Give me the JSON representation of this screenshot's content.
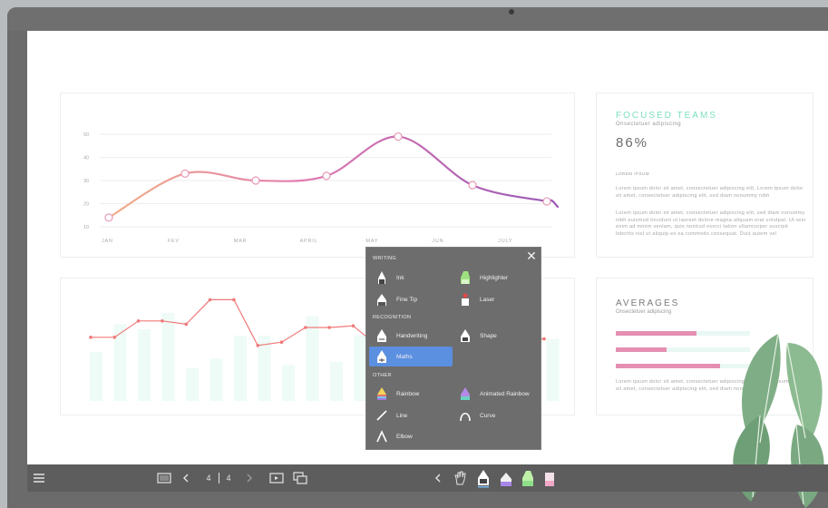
{
  "line_chart": {
    "y_ticks": [
      "50",
      "40",
      "30",
      "20",
      "10"
    ],
    "x_labels": [
      "JAN",
      "FEV",
      "MAR",
      "APRIL",
      "MAY",
      "JUN",
      "JULY"
    ],
    "chart_data": {
      "type": "line",
      "x": [
        1,
        2,
        3,
        4,
        5,
        6,
        7,
        8
      ],
      "values": [
        14,
        33,
        30,
        32,
        49,
        28,
        21
      ],
      "ylim": [
        10,
        50
      ],
      "grid": true,
      "line_colors": [
        "#f2b089",
        "#e07bb0",
        "#9b59b6"
      ]
    }
  },
  "bar_chart": {
    "chart_data": {
      "type": "bar",
      "bar_values": [
        30,
        47,
        44,
        54,
        20,
        26,
        40,
        40,
        22,
        52,
        24,
        40,
        40,
        38,
        38,
        38,
        38,
        40,
        38,
        38
      ],
      "line_values": [
        39,
        39,
        49,
        49,
        47,
        62,
        62,
        34,
        36,
        45,
        45,
        46,
        34,
        42,
        57,
        57,
        36,
        36,
        38,
        38
      ],
      "bar_color": "#eefbf6",
      "line_color": "#f07a7a"
    }
  },
  "focused_teams": {
    "title": "FOCUSED TEAMS",
    "subtitle": "Onsectetuer adipiscing",
    "value": "86%",
    "lorem_heading": "LOREM IPSUM",
    "para1": "Lorem ipsum dolor sit amet, consectetuer adipiscing elit, Lorem ipsum dolor sit amet, consectetuer adipiscing elit, sed diam nonummy nibh",
    "para2": "Lorem ipsum dolor sit amet, consectetuer adipiscing elit, sed diam nonummy nibh euismod tincidunt ut laoreet dolore magna aliquam erat volutpat. Ut wisi enim ad minim veniam, quis nostrud exerci tation ullamcorper suscipit lobortis nisl ut aliquip ex ea commodo consequat. Duis autem vel"
  },
  "averages": {
    "title": "AVERAGES",
    "subtitle": "Onsectetuer adipiscing",
    "bars": [
      0.6,
      0.38,
      0.78
    ],
    "para": "Lorem ipsum dolor sit amet, consectetuer adipiscing elit, Lorem ipsum dolor sit amet, consectetuer adipiscing elit, sed diam nonummy nibh"
  },
  "popup": {
    "sections": {
      "writing": "WRITING",
      "recognition": "RECOGNITION",
      "other": "OTHER"
    },
    "items": {
      "ink": "Ink",
      "highlighter": "Highlighter",
      "fine_tip": "Fine Tip",
      "laser": "Laser",
      "handwriting": "Handwriting",
      "shape": "Shape",
      "maths": "Maths",
      "rainbow": "Rainbow",
      "animated_rainbow": "Animated Rainbow",
      "line": "Line",
      "curve": "Curve",
      "elbow": "Elbow"
    },
    "selected": "maths",
    "close_icon": "close-icon"
  },
  "taskbar": {
    "page_current": "4",
    "page_total": "4",
    "icons": [
      "menu-icon",
      "whiteboard-icon",
      "prev-page-icon",
      "next-page-icon",
      "present-icon",
      "windows-icon",
      "collapse-icon",
      "hand-icon",
      "pen-icon",
      "fine-pen-icon",
      "highlighter-icon",
      "eraser-icon"
    ]
  },
  "colors": {
    "accent_teal": "#7ce0c0",
    "accent_pink": "#e58fb2",
    "popup_bg": "#6d6d6d",
    "selected_bg": "#5b8fe0"
  }
}
